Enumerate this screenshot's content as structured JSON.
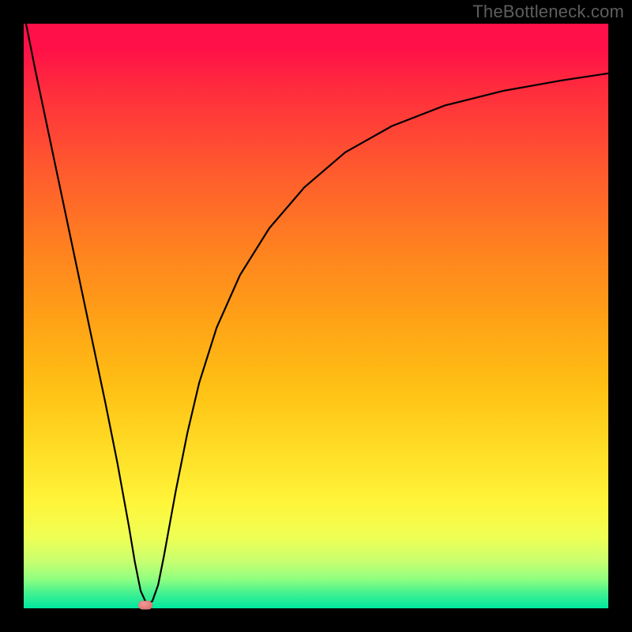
{
  "watermark": "TheBottleneck.com",
  "chart_data": {
    "type": "line",
    "title": "",
    "xlabel": "",
    "ylabel": "",
    "xlim": [
      0,
      100
    ],
    "ylim": [
      0,
      100
    ],
    "grid": false,
    "series": [
      {
        "name": "bottleneck-curve",
        "x": [
          0.4,
          2,
          4,
          6,
          8,
          10,
          12,
          14,
          16,
          18,
          19,
          20,
          21,
          22,
          23,
          24,
          26,
          28,
          30,
          33,
          37,
          42,
          48,
          55,
          63,
          72,
          82,
          92,
          100
        ],
        "y": [
          100,
          92,
          82.5,
          73,
          63.5,
          54,
          44.5,
          35,
          25,
          14,
          8,
          3,
          0.8,
          1.2,
          4,
          9,
          20,
          30,
          38.5,
          48,
          57,
          65,
          72,
          78,
          82.5,
          86,
          88.5,
          90.3,
          91.5
        ]
      }
    ],
    "marker": {
      "x": 20.8,
      "y": 0.6,
      "name": "optimal-point"
    },
    "background": {
      "type": "vertical-gradient",
      "stops": [
        {
          "pos": 0.0,
          "color": "#ff1048"
        },
        {
          "pos": 0.5,
          "color": "#ffa016"
        },
        {
          "pos": 0.82,
          "color": "#fff53a"
        },
        {
          "pos": 1.0,
          "color": "#00e8a0"
        }
      ]
    }
  }
}
